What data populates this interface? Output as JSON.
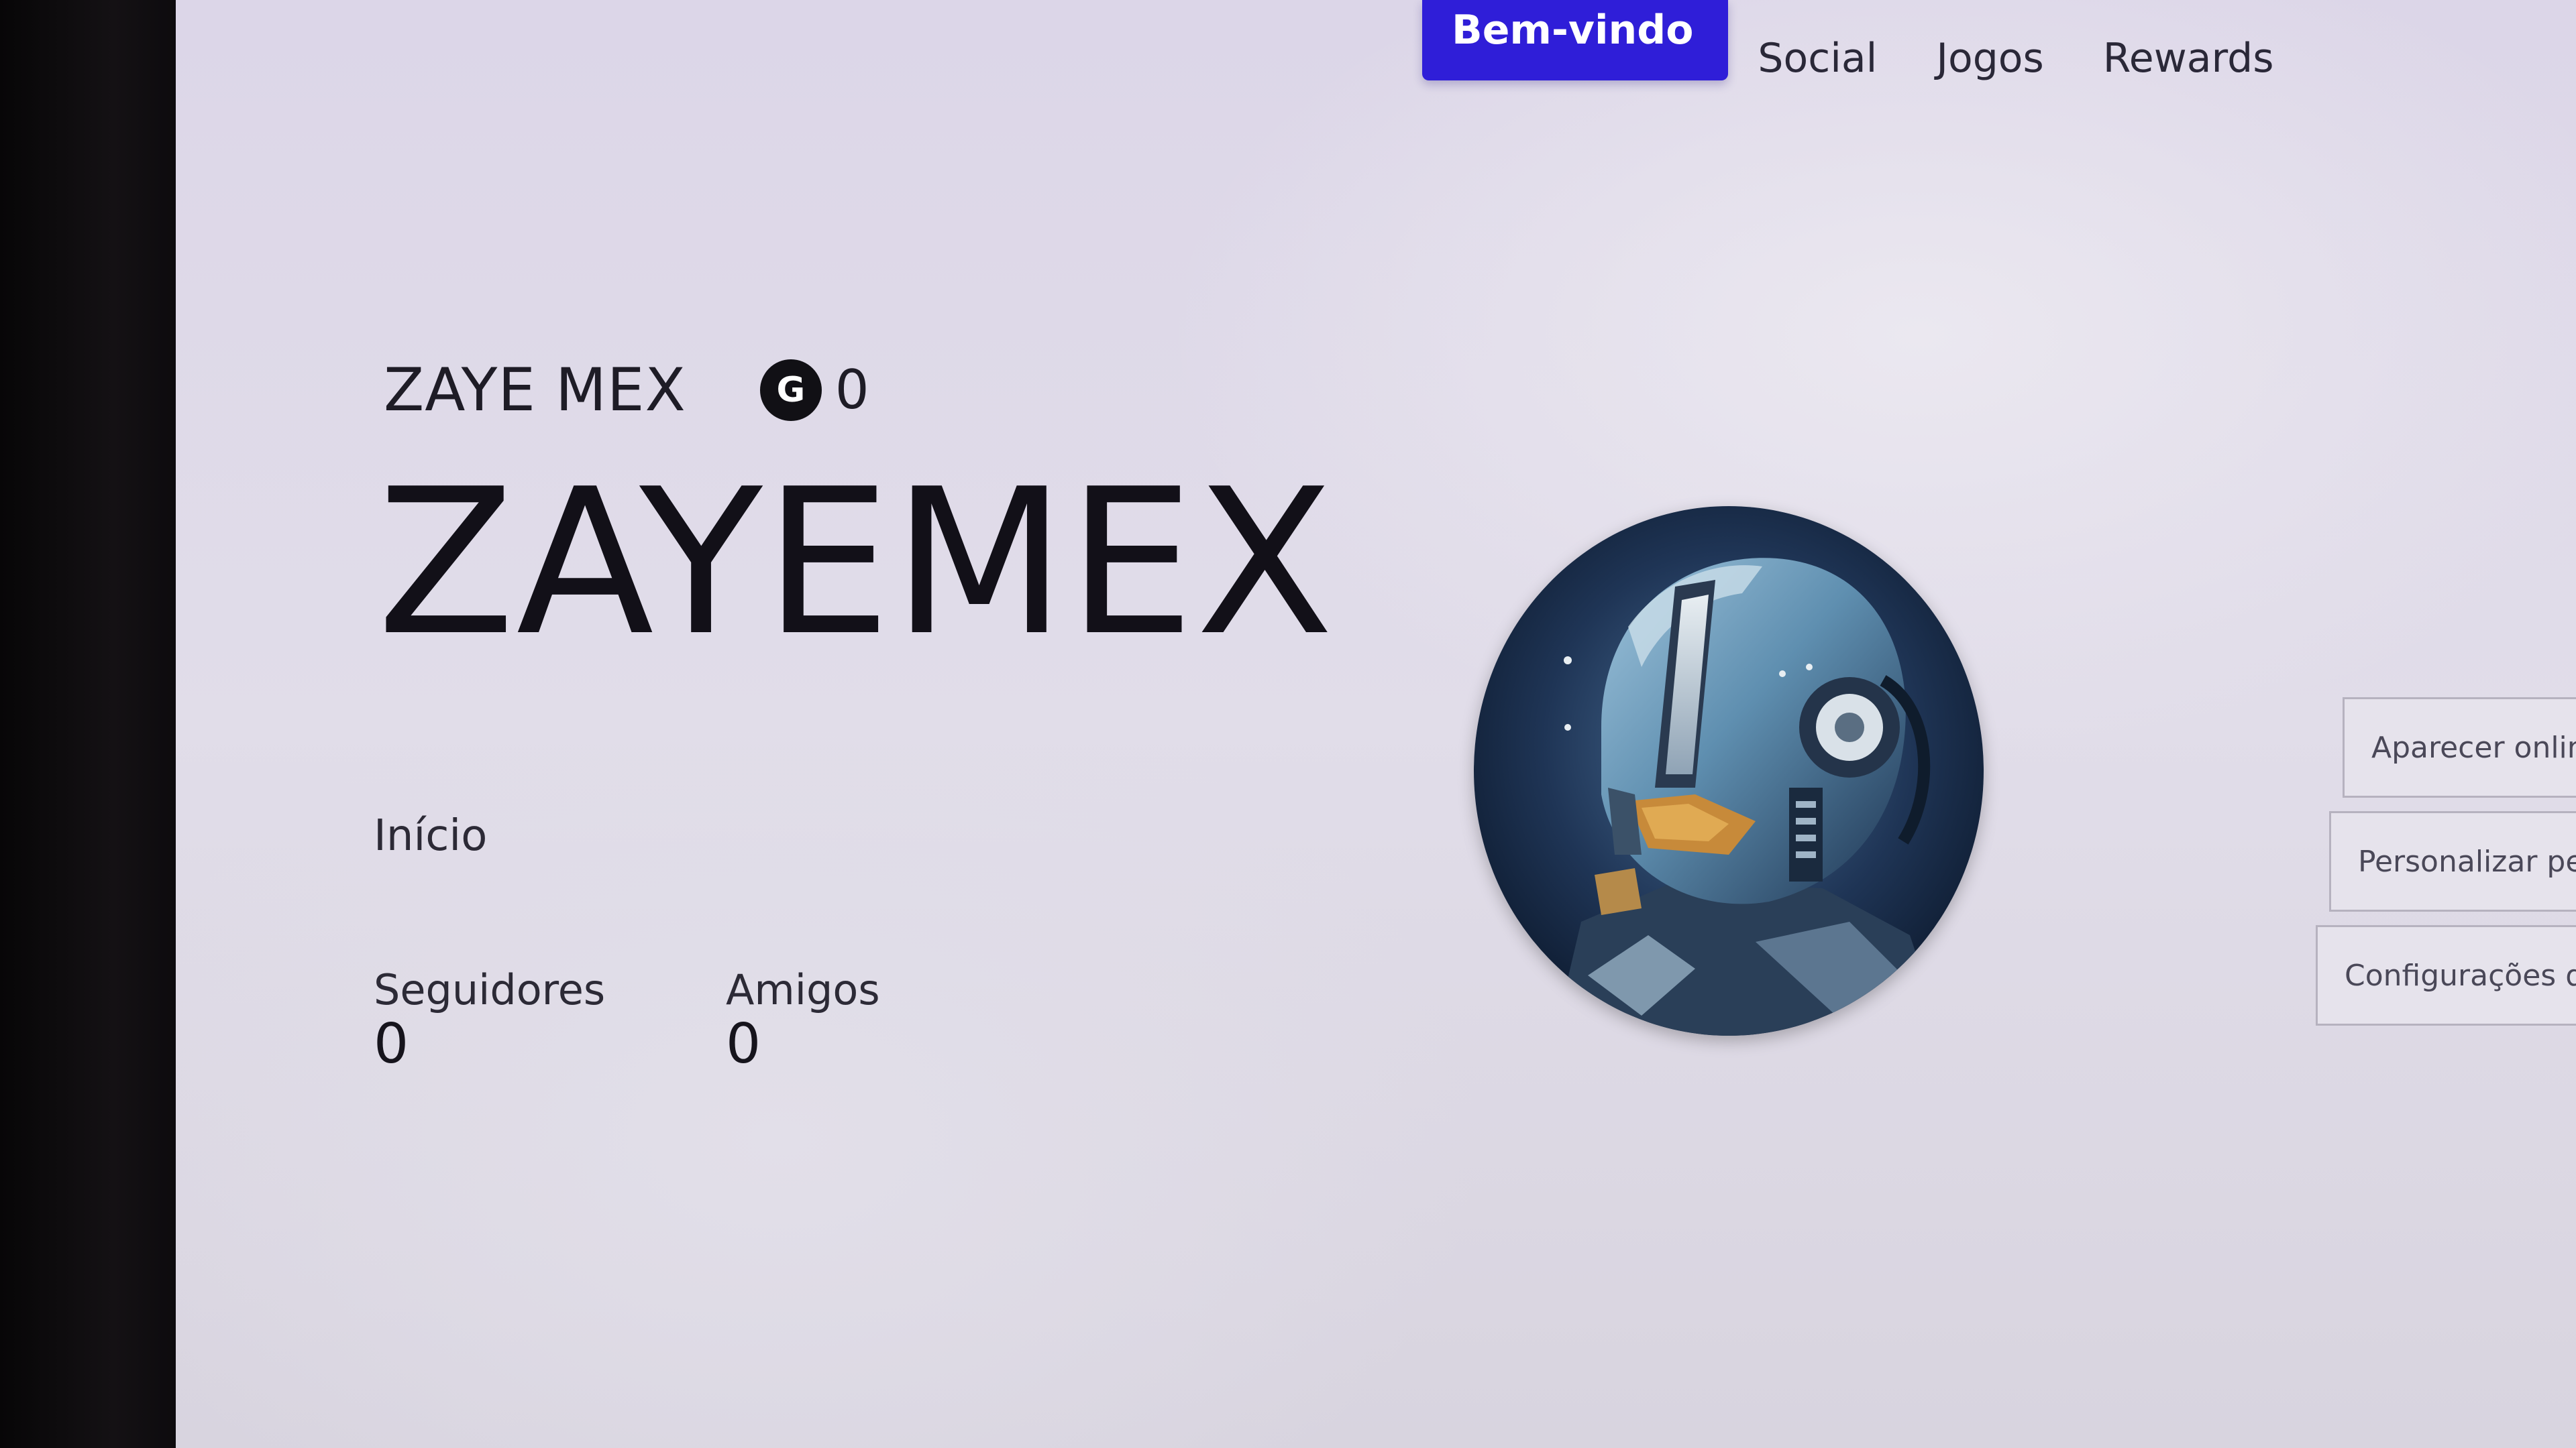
{
  "nav": {
    "tabs": [
      {
        "label": "Bem-vindo",
        "active": true
      },
      {
        "label": "Social",
        "active": false
      },
      {
        "label": "Jogos",
        "active": false
      },
      {
        "label": "Rewards",
        "active": false
      }
    ]
  },
  "profile": {
    "gamertag_small": "ZAYE MEX",
    "gamerscore_icon_letter": "G",
    "gamerscore": "0",
    "gamertag_large": "ZAYEMEX",
    "home_label": "Início",
    "stats": [
      {
        "label": "Seguidores",
        "value": "0"
      },
      {
        "label": "Amigos",
        "value": "0"
      }
    ],
    "avatar_icon": "helmeted-robot-avatar"
  },
  "actions": {
    "appear_online": "Aparecer onlin",
    "customize_profile": "Personalizar per",
    "settings": "Configurações de"
  },
  "colors": {
    "accent": "#2f1ed8",
    "background": "#e1dde9",
    "text": "#121018"
  }
}
